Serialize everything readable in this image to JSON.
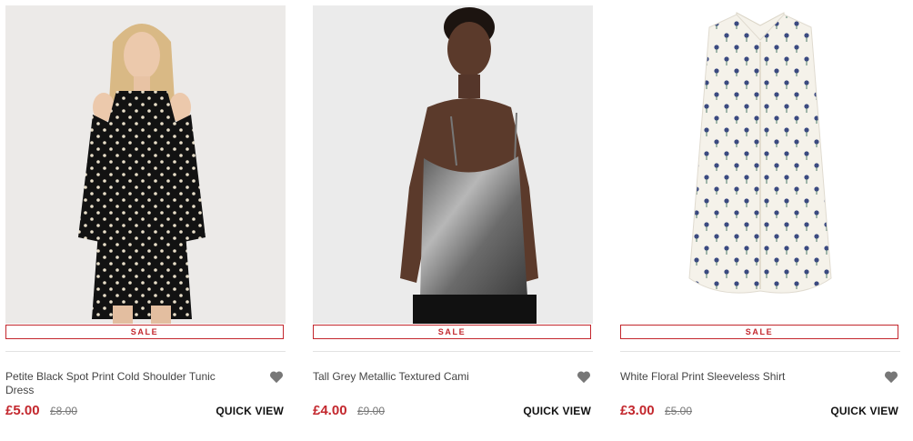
{
  "products": [
    {
      "name": "Petite Black Spot Print Cold Shoulder Tunic Dress",
      "sale_label": "SALE",
      "price": "£5.00",
      "was_price": "£8.00",
      "quick_view": "QUICK VIEW",
      "wishlist_icon": "heart-icon"
    },
    {
      "name": "Tall Grey Metallic Textured Cami",
      "sale_label": "SALE",
      "price": "£4.00",
      "was_price": "£9.00",
      "quick_view": "QUICK VIEW",
      "wishlist_icon": "heart-icon"
    },
    {
      "name": "White Floral Print Sleeveless Shirt",
      "sale_label": "SALE",
      "price": "£3.00",
      "was_price": "£5.00",
      "quick_view": "QUICK VIEW",
      "wishlist_icon": "heart-icon"
    }
  ],
  "colors": {
    "sale_red": "#c3272d",
    "text": "#444444",
    "heart": "#777777"
  }
}
